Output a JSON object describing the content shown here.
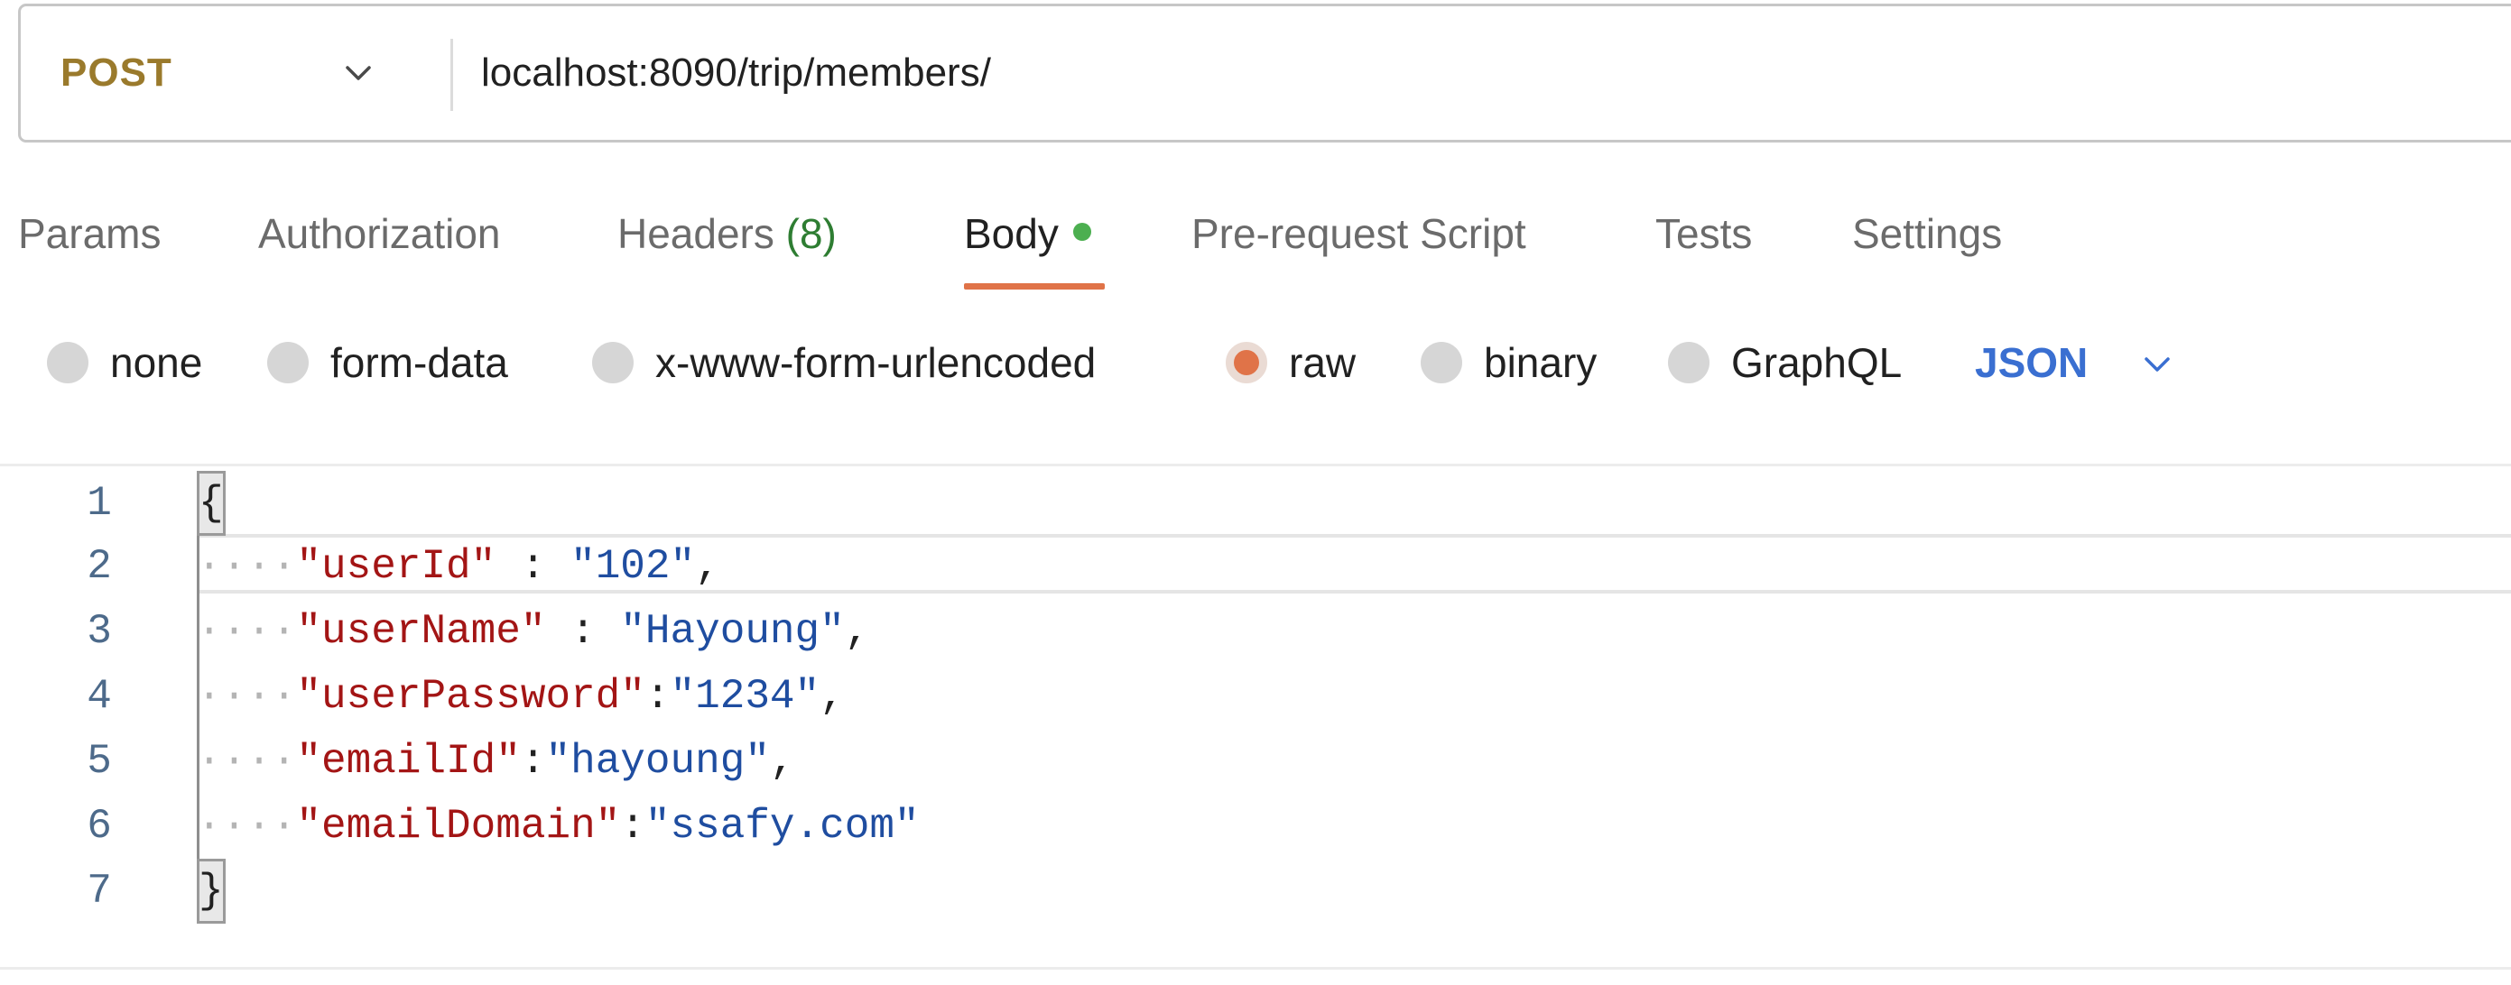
{
  "request": {
    "method": "POST",
    "url": "localhost:8090/trip/members/"
  },
  "tabs": [
    {
      "label": "Params"
    },
    {
      "label": "Authorization"
    },
    {
      "label": "Headers",
      "count": "(8)"
    },
    {
      "label": "Body",
      "active": true,
      "indicator": "green-dot"
    },
    {
      "label": "Pre-request Script"
    },
    {
      "label": "Tests"
    },
    {
      "label": "Settings"
    }
  ],
  "body_types": [
    {
      "label": "none",
      "checked": false
    },
    {
      "label": "form-data",
      "checked": false
    },
    {
      "label": "x-www-form-urlencoded",
      "checked": false
    },
    {
      "label": "raw",
      "checked": true
    },
    {
      "label": "binary",
      "checked": false
    },
    {
      "label": "GraphQL",
      "checked": false
    }
  ],
  "raw_language": "JSON",
  "editor": {
    "line_numbers": [
      "1",
      "2",
      "3",
      "4",
      "5",
      "6",
      "7"
    ],
    "open_brace": "{",
    "close_brace": "}",
    "entries": [
      {
        "key": "\"userId\"",
        "sep": " : ",
        "value": "\"102\"",
        "comma": ","
      },
      {
        "key": "\"userName\"",
        "sep": " : ",
        "value": "\"Hayoung\"",
        "comma": ","
      },
      {
        "key": "\"userPassword\"",
        "sep": ":",
        "value": "\"1234\"",
        "comma": ","
      },
      {
        "key": "\"emailId\"",
        "sep": ":",
        "value": "\"hayoung\"",
        "comma": ","
      },
      {
        "key": "\"emailDomain\"",
        "sep": ":",
        "value": "\"ssafy.com\"",
        "comma": ""
      }
    ],
    "indent": "····"
  },
  "colors": {
    "method": "#9a7a2c",
    "accent_underline": "#e07348",
    "tab_dot": "#4caf50",
    "count": "#2e7d32",
    "language": "#3a6fd1",
    "json_key": "#a31515",
    "json_value": "#1f4da0"
  },
  "icons": {
    "method_dropdown": "chevron-down-icon",
    "language_dropdown": "chevron-down-icon"
  }
}
